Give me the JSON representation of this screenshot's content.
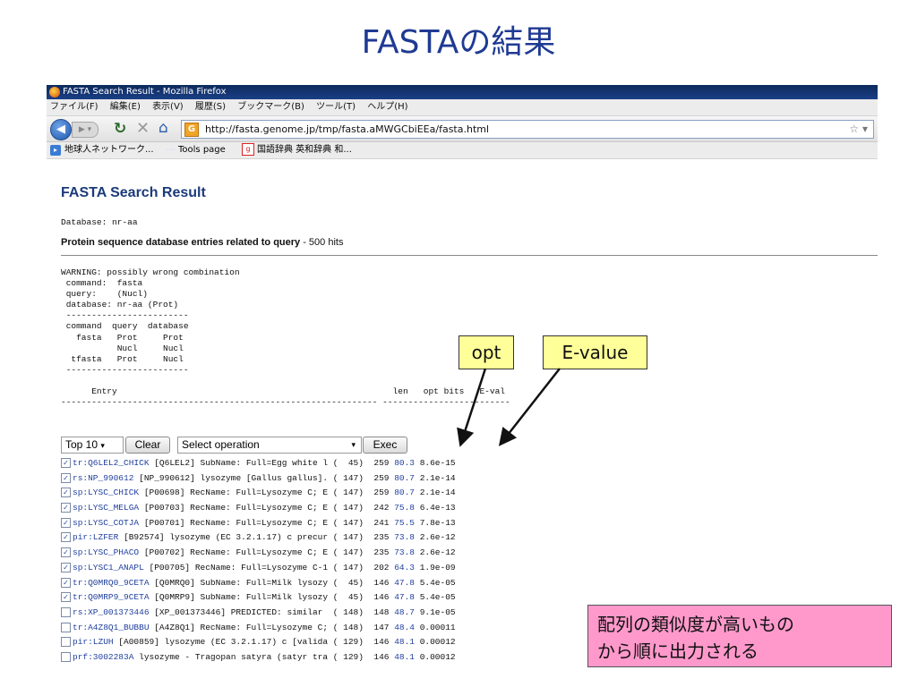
{
  "slide_title": "FASTAの結果",
  "browser": {
    "window_title": "FASTA Search Result - Mozilla Firefox",
    "menu": [
      "ファイル(F)",
      "編集(E)",
      "表示(V)",
      "履歴(S)",
      "ブックマーク(B)",
      "ツール(T)",
      "ヘルプ(H)"
    ],
    "url": "http://fasta.genome.jp/tmp/fasta.aMWGCbiEEa/fasta.html",
    "bookmarks": {
      "item1": "地球人ネットワーク...",
      "item2": "Tools page",
      "item3": "国語辞典 英和辞典 和..."
    }
  },
  "page": {
    "heading": "FASTA Search Result",
    "database_line": "Database: nr-aa",
    "section_title": "Protein sequence database entries related to query",
    "section_hits": " - 500 hits",
    "warning": "WARNING: possibly wrong combination\n command:  fasta\n query:    (Nucl)\n database: nr-aa (Prot)\n ------------------------\n command  query  database\n   fasta   Prot     Prot\n           Nucl     Nucl\n  tfasta   Prot     Nucl\n ------------------------\n\n      Entry                                                      len   opt bits   E-val\n-------------------------------------------------------------- -------------------------",
    "controls": {
      "top_select": "Top 10",
      "clear_label": "Clear",
      "operation_select": "Select operation",
      "exec_label": "Exec"
    },
    "rows": [
      {
        "checked": true,
        "acc": "tr:Q6LEL2_CHICK",
        "desc": " [Q6LEL2] SubName: Full=Egg white l (  45)",
        "len": "259",
        "opt": "80.3",
        "eval": "8.6e-15"
      },
      {
        "checked": true,
        "acc": "rs:NP_990612",
        "desc": " [NP_990612] lysozyme [Gallus gallus]. ( 147)",
        "len": "259",
        "opt": "80.7",
        "eval": "2.1e-14"
      },
      {
        "checked": true,
        "acc": "sp:LYSC_CHICK",
        "desc": " [P00698] RecName: Full=Lysozyme C; E ( 147)",
        "len": "259",
        "opt": "80.7",
        "eval": "2.1e-14"
      },
      {
        "checked": true,
        "acc": "sp:LYSC_MELGA",
        "desc": " [P00703] RecName: Full=Lysozyme C; E ( 147)",
        "len": "242",
        "opt": "75.8",
        "eval": "6.4e-13"
      },
      {
        "checked": true,
        "acc": "sp:LYSC_COTJA",
        "desc": " [P00701] RecName: Full=Lysozyme C; E ( 147)",
        "len": "241",
        "opt": "75.5",
        "eval": "7.8e-13"
      },
      {
        "checked": true,
        "acc": "pir:LZFER",
        "desc": " [B92574] lysozyme (EC 3.2.1.17) c precur ( 147)",
        "len": "235",
        "opt": "73.8",
        "eval": "2.6e-12"
      },
      {
        "checked": true,
        "acc": "sp:LYSC_PHACO",
        "desc": " [P00702] RecName: Full=Lysozyme C; E ( 147)",
        "len": "235",
        "opt": "73.8",
        "eval": "2.6e-12"
      },
      {
        "checked": true,
        "acc": "sp:LYSC1_ANAPL",
        "desc": " [P00705] RecName: Full=Lysozyme C-1 ( 147)",
        "len": "202",
        "opt": "64.3",
        "eval": "1.9e-09"
      },
      {
        "checked": true,
        "acc": "tr:Q0MRQ0_9CETA",
        "desc": " [Q0MRQ0] SubName: Full=Milk lysozy (  45)",
        "len": "146",
        "opt": "47.8",
        "eval": "5.4e-05"
      },
      {
        "checked": true,
        "acc": "tr:Q0MRP9_9CETA",
        "desc": " [Q0MRP9] SubName: Full=Milk lysozy (  45)",
        "len": "146",
        "opt": "47.8",
        "eval": "5.4e-05"
      },
      {
        "checked": false,
        "acc": "rs:XP_001373446",
        "desc": " [XP_001373446] PREDICTED: similar  ( 148)",
        "len": "148",
        "opt": "48.7",
        "eval": "9.1e-05"
      },
      {
        "checked": false,
        "acc": "tr:A4Z8Q1_BUBBU",
        "desc": " [A4Z8Q1] RecName: Full=Lysozyme C; ( 148)",
        "len": "147",
        "opt": "48.4",
        "eval": "0.00011"
      },
      {
        "checked": false,
        "acc": "pir:LZUH",
        "desc": " [A00859] lysozyme (EC 3.2.1.17) c [valida ( 129)",
        "len": "146",
        "opt": "48.1",
        "eval": "0.00012"
      },
      {
        "checked": false,
        "acc": "prf:3002283A",
        "desc": " lysozyme - Tragopan satyra (satyr tra ( 129)",
        "len": "146",
        "opt": "48.1",
        "eval": "0.00012"
      }
    ]
  },
  "annotations": {
    "opt_label": "opt",
    "evalue_label": "E-value",
    "note_line1": "配列の類似度が高いもの",
    "note_line2": "から順に出力される"
  }
}
